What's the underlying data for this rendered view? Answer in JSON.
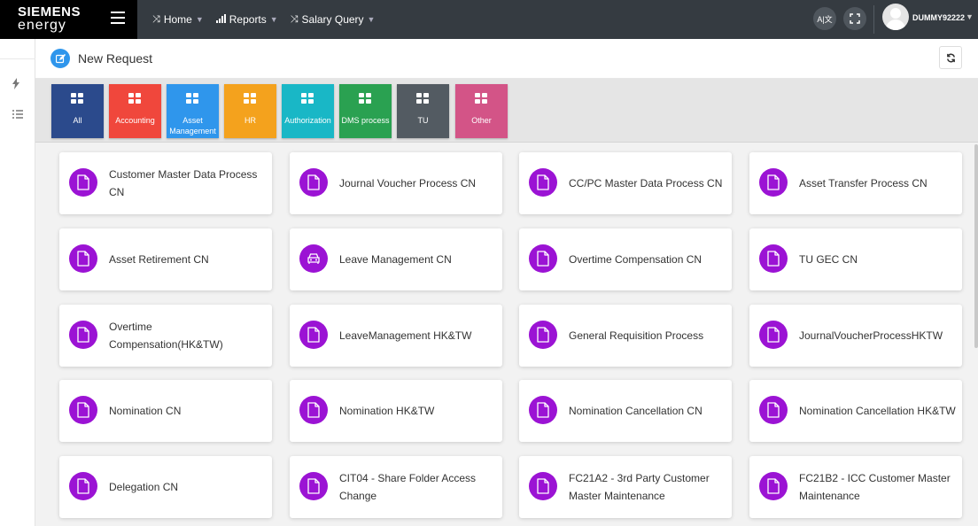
{
  "brand": {
    "line1": "SIEMENS",
    "line2": "energy"
  },
  "nav": [
    {
      "icon": "shuffle-icon",
      "label": "Home"
    },
    {
      "icon": "bar-chart-icon",
      "label": "Reports"
    },
    {
      "icon": "shuffle-icon",
      "label": "Salary Query"
    }
  ],
  "topbar": {
    "translate_label": "A|文",
    "username": "DUMMY92222"
  },
  "header": {
    "title": "New Request"
  },
  "categories": [
    {
      "label": "All",
      "color": "#2b4a8c"
    },
    {
      "label": "Accounting",
      "color": "#f0473c"
    },
    {
      "label": "Asset Management",
      "color": "#2f96ec"
    },
    {
      "label": "HR",
      "color": "#f4a21d"
    },
    {
      "label": "Authorization",
      "color": "#19b7c6"
    },
    {
      "label": "DMS process",
      "color": "#2aa151"
    },
    {
      "label": "TU",
      "color": "#535b62"
    },
    {
      "label": "Other",
      "color": "#d35487"
    }
  ],
  "cards": [
    {
      "title": "Customer Master Data Process CN",
      "icon": "document-icon"
    },
    {
      "title": "Journal Voucher Process CN",
      "icon": "document-icon"
    },
    {
      "title": "CC/PC Master Data Process CN",
      "icon": "document-icon"
    },
    {
      "title": "Asset Transfer Process CN",
      "icon": "document-icon"
    },
    {
      "title": "Asset Retirement CN",
      "icon": "document-icon"
    },
    {
      "title": "Leave Management CN",
      "icon": "car-icon"
    },
    {
      "title": "Overtime Compensation CN",
      "icon": "document-icon"
    },
    {
      "title": "TU GEC CN",
      "icon": "document-icon"
    },
    {
      "title": "Overtime Compensation(HK&TW)",
      "icon": "document-icon"
    },
    {
      "title": "LeaveManagement HK&TW",
      "icon": "document-icon"
    },
    {
      "title": "General Requisition Process",
      "icon": "document-icon"
    },
    {
      "title": "JournalVoucherProcessHKTW",
      "icon": "document-icon"
    },
    {
      "title": "Nomination CN",
      "icon": "document-icon"
    },
    {
      "title": "Nomination HK&TW",
      "icon": "document-icon"
    },
    {
      "title": "Nomination Cancellation CN",
      "icon": "document-icon"
    },
    {
      "title": "Nomination Cancellation HK&TW",
      "icon": "document-icon"
    },
    {
      "title": "Delegation CN",
      "icon": "document-icon"
    },
    {
      "title": "CIT04 - Share Folder Access Change",
      "icon": "document-icon"
    },
    {
      "title": "FC21A2 - 3rd Party Customer Master Maintenance",
      "icon": "document-icon"
    },
    {
      "title": "FC21B2 - ICC Customer Master Maintenance",
      "icon": "document-icon"
    }
  ],
  "colors": {
    "card_icon": "#9b13d4",
    "topbar": "#353b41",
    "accent": "#2f96ec"
  }
}
